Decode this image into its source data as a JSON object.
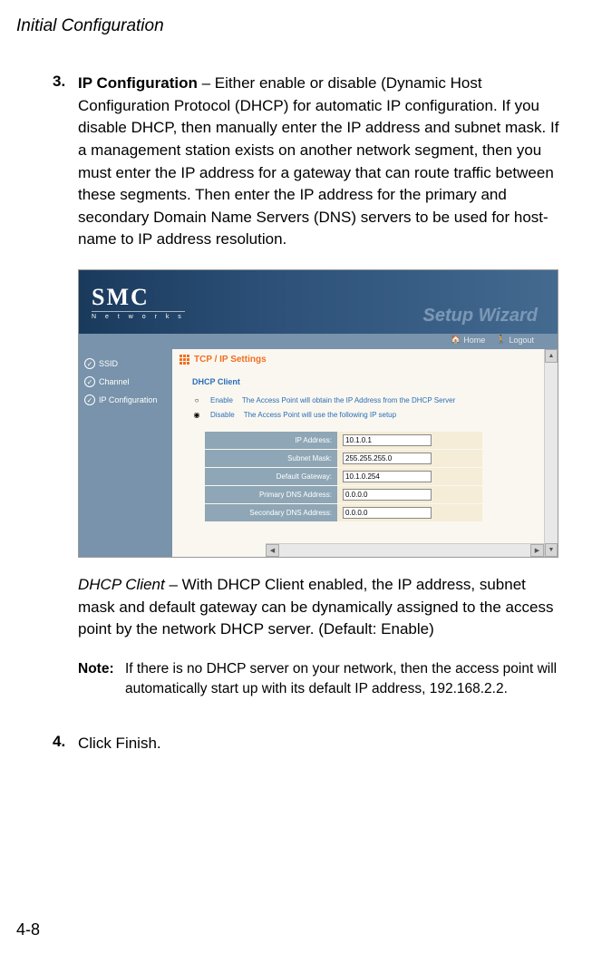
{
  "header": {
    "title": "Initial Configuration"
  },
  "items": {
    "item3": {
      "num": "3.",
      "title": "IP Configuration",
      "text": " – Either enable or disable (Dynamic Host Configuration Protocol (DHCP) for automatic IP configuration. If you disable DHCP, then manually enter the IP address and subnet mask. If a management station exists on another network segment, then you must enter the IP address for a gateway that can route traffic between these segments. Then enter the IP address for the primary and secondary Domain Name Servers (DNS) servers to be used for host-name to IP address resolution."
    },
    "item4": {
      "num": "4.",
      "text": "Click Finish."
    }
  },
  "screenshot": {
    "logo": {
      "main": "SMC",
      "sub": "N e t w o r k s"
    },
    "wizard_title": "Setup Wizard",
    "toplinks": {
      "home": "Home",
      "logout": "Logout"
    },
    "sidebar": {
      "ssid": "SSID",
      "channel": "Channel",
      "ipconfig": "IP Configuration"
    },
    "section_title": "TCP / IP Settings",
    "sub_title": "DHCP Client",
    "radios": {
      "enable": {
        "label": "Enable",
        "desc": "The Access Point  will obtain the IP Address from the DHCP Server"
      },
      "disable": {
        "label": "Disable",
        "desc": "The Access Point will use the following IP setup"
      }
    },
    "fields": {
      "ip": {
        "label": "IP Address:",
        "value": "10.1.0.1"
      },
      "subnet": {
        "label": "Subnet Mask:",
        "value": "255.255.255.0"
      },
      "gateway": {
        "label": "Default Gateway:",
        "value": "10.1.0.254"
      },
      "dns1": {
        "label": "Primary DNS Address:",
        "value": "0.0.0.0"
      },
      "dns2": {
        "label": "Secondary DNS Address:",
        "value": "0.0.0.0"
      }
    }
  },
  "dhcp_para": {
    "lead": "DHCP Client –",
    "text": " With DHCP Client enabled, the IP address, subnet mask and default gateway can be dynamically assigned to the access point by the network DHCP server. (Default: Enable)"
  },
  "note": {
    "label": "Note:",
    "text": "If there is no DHCP server on your network, then the access point will automatically start up with its default IP address, 192.168.2.2."
  },
  "page_num": "4-8"
}
